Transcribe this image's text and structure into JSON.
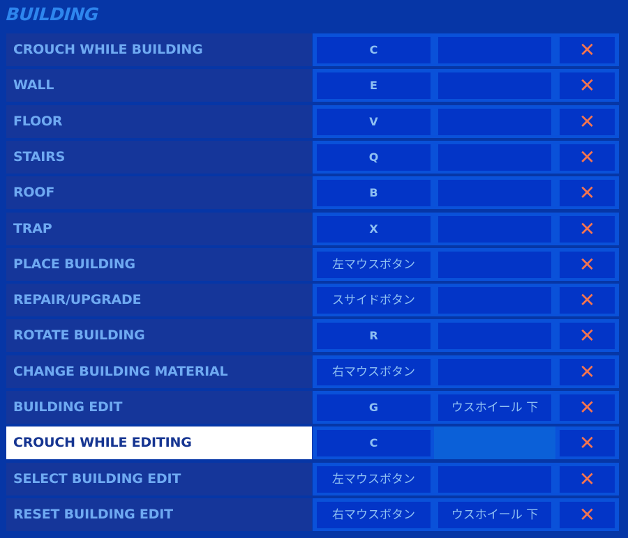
{
  "section_title": "BUILDING",
  "colors": {
    "background": "#0636a6",
    "title": "#2e86ee",
    "label_bg": "#15369a",
    "label_text": "#6faaf2",
    "selected_bg": "#ffffff",
    "selected_text": "#163591",
    "key_cell_bg": "#0335c7",
    "key_frame": "#0a51d9",
    "delete_icon": "#f4744f"
  },
  "delete_glyph": "✕",
  "bindings": [
    {
      "action": "CROUCH WHILE BUILDING",
      "key1": "C",
      "key2": ""
    },
    {
      "action": "WALL",
      "key1": "E",
      "key2": ""
    },
    {
      "action": "FLOOR",
      "key1": "V",
      "key2": ""
    },
    {
      "action": "STAIRS",
      "key1": "Q",
      "key2": ""
    },
    {
      "action": "ROOF",
      "key1": "B",
      "key2": ""
    },
    {
      "action": "TRAP",
      "key1": "X",
      "key2": ""
    },
    {
      "action": "PLACE BUILDING",
      "key1": "左マウスボタン",
      "key2": ""
    },
    {
      "action": "REPAIR/UPGRADE",
      "key1": "スサイドボタン",
      "key2": ""
    },
    {
      "action": "ROTATE BUILDING",
      "key1": "R",
      "key2": ""
    },
    {
      "action": "CHANGE BUILDING MATERIAL",
      "key1": "右マウスボタン",
      "key2": ""
    },
    {
      "action": "BUILDING EDIT",
      "key1": "G",
      "key2": "ウスホイール 下"
    },
    {
      "action": "CROUCH WHILE EDITING",
      "key1": "C",
      "key2": "",
      "selected": true
    },
    {
      "action": "SELECT BUILDING EDIT",
      "key1": "左マウスボタン",
      "key2": ""
    },
    {
      "action": "RESET BUILDING EDIT",
      "key1": "右マウスボタン",
      "key2": "ウスホイール 下"
    }
  ]
}
